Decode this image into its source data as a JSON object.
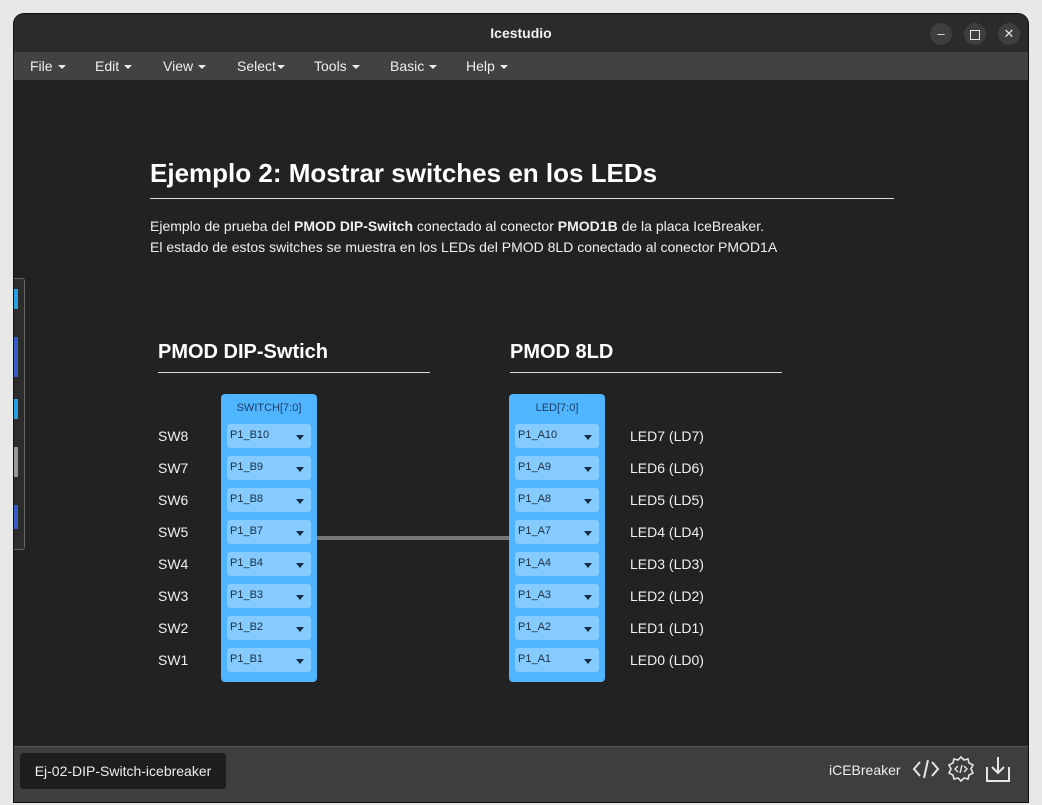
{
  "window": {
    "title": "Icestudio"
  },
  "menu": [
    {
      "label": "File"
    },
    {
      "label": "Edit"
    },
    {
      "label": "View"
    },
    {
      "label": "Select"
    },
    {
      "label": "Tools"
    },
    {
      "label": "Basic"
    },
    {
      "label": "Help"
    }
  ],
  "content": {
    "heading": "Ejemplo 2: Mostrar switches en los LEDs",
    "desc1": {
      "t1": "Ejemplo de prueba del ",
      "b1": "PMOD DIP-Switch",
      "t2": " conectado al conector ",
      "b2": "PMOD1B",
      "t3": " de la placa IceBreaker."
    },
    "desc2": "El estado de estos switches se muestra en los LEDs del PMOD 8LD conectado al conector PMOD1A",
    "left_title": "PMOD DIP-Swtich",
    "right_title": "PMOD 8LD"
  },
  "switch_block": {
    "label": "SWITCH[7:0]",
    "pins": [
      "P1_B10",
      "P1_B9",
      "P1_B8",
      "P1_B7",
      "P1_B4",
      "P1_B3",
      "P1_B2",
      "P1_B1"
    ],
    "labels": [
      "SW8",
      "SW7",
      "SW6",
      "SW5",
      "SW4",
      "SW3",
      "SW2",
      "SW1"
    ]
  },
  "led_block": {
    "label": "LED[7:0]",
    "pins": [
      "P1_A10",
      "P1_A9",
      "P1_A8",
      "P1_A7",
      "P1_A4",
      "P1_A3",
      "P1_A2",
      "P1_A1"
    ],
    "labels": [
      "LED7 (LD7)",
      "LED6 (LD6)",
      "LED5 (LD5)",
      "LED4 (LD4)",
      "LED3 (LD3)",
      "LED2 (LD2)",
      "LED1 (LD1)",
      "LED0 (LD0)"
    ]
  },
  "footer": {
    "file_tab": "Ej-02-DIP-Switch-icebreaker",
    "board": "iCEBreaker",
    "icons": [
      "code-icon",
      "settings-code-icon",
      "download-icon"
    ]
  },
  "colors": {
    "block": "#4fb5ff",
    "pin": "#85cbff",
    "background": "#222222",
    "wire": "#777777"
  }
}
